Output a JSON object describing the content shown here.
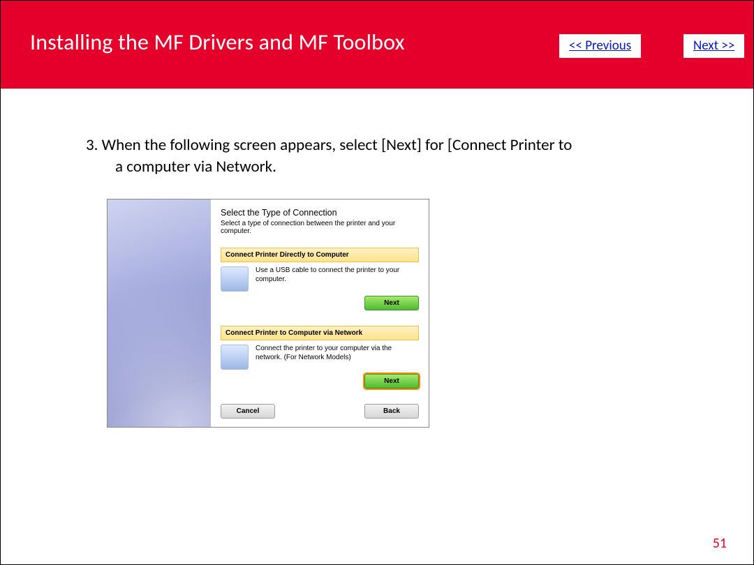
{
  "header": {
    "title": "Installing the MF Drivers and MF Toolbox",
    "prev_label": "<< Previous",
    "next_label": "Next >>"
  },
  "step": {
    "prefix": "3. When the following screen appears, select [Next] for [Connect Printer to",
    "line2": "a computer via Network."
  },
  "dialog": {
    "heading": "Select the Type of Connection",
    "sub": "Select a type of connection between the printer and your computer.",
    "options": [
      {
        "title": "Connect Printer Directly to Computer",
        "desc": "Use a USB cable to connect the printer to your computer.",
        "btn": "Next",
        "highlight": false
      },
      {
        "title": "Connect Printer to Computer via Network",
        "desc": "Connect the printer to your computer via the network. (For Network Models)",
        "btn": "Next",
        "highlight": true
      }
    ],
    "cancel": "Cancel",
    "back": "Back"
  },
  "page_number": "51"
}
